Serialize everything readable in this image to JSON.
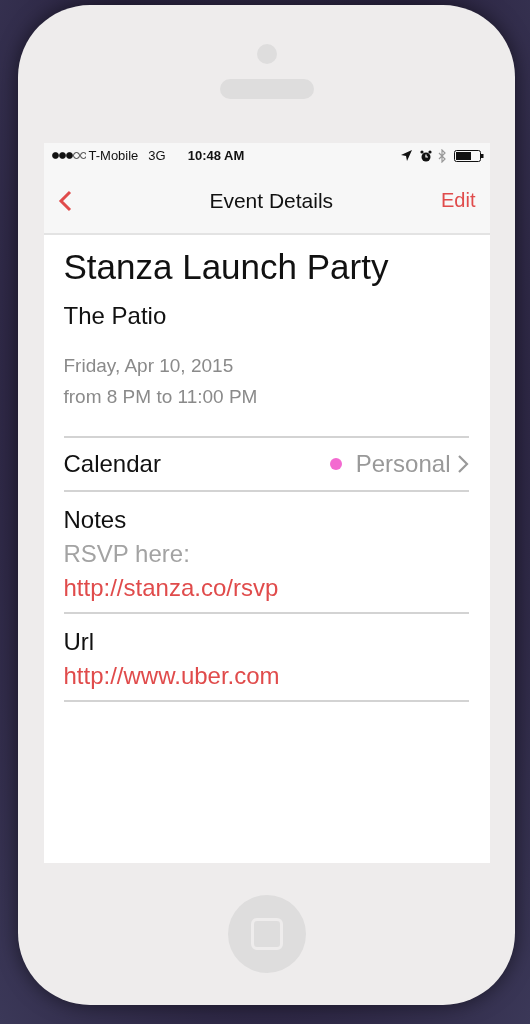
{
  "status_bar": {
    "carrier": "T-Mobile",
    "network": "3G",
    "time": "10:48 AM"
  },
  "nav": {
    "title": "Event Details",
    "action": "Edit"
  },
  "event": {
    "title": "Stanza Launch Party",
    "location": "The Patio",
    "date": "Friday, Apr 10, 2015",
    "time": "from 8 PM to 11:00 PM"
  },
  "calendar": {
    "label": "Calendar",
    "value": "Personal",
    "color": "#f36ad0"
  },
  "sections": [
    {
      "label": "Notes",
      "lines": [
        {
          "kind": "text",
          "text": "RSVP here:"
        },
        {
          "kind": "link",
          "text": "http://stanza.co/rsvp"
        }
      ]
    },
    {
      "label": "Url",
      "lines": [
        {
          "kind": "link",
          "text": "http://www.uber.com"
        }
      ]
    }
  ]
}
